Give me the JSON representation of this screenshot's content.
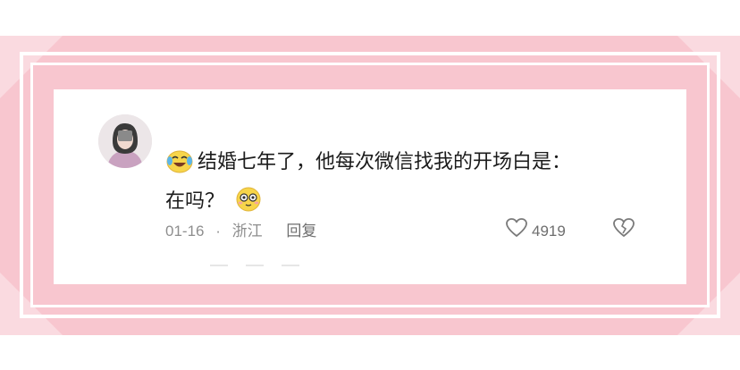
{
  "comment": {
    "text_line1": "结婚七年了，他每次微信找我的开场白是：",
    "text_line2": "在吗？",
    "prefix_emoji": "laughing-crying-emoji",
    "suffix_emoji": "dazed-smiley-emoji"
  },
  "meta": {
    "date": "01-16",
    "separator": "·",
    "location": "浙江",
    "reply_label": "回复",
    "like_count": "4919"
  },
  "icons": {
    "like": "heart-outline-icon",
    "dislike": "broken-heart-icon"
  },
  "colors": {
    "frame_pink": "#f8c6cf",
    "text": "#1c1c1c",
    "meta_text": "#8e8e8e"
  }
}
